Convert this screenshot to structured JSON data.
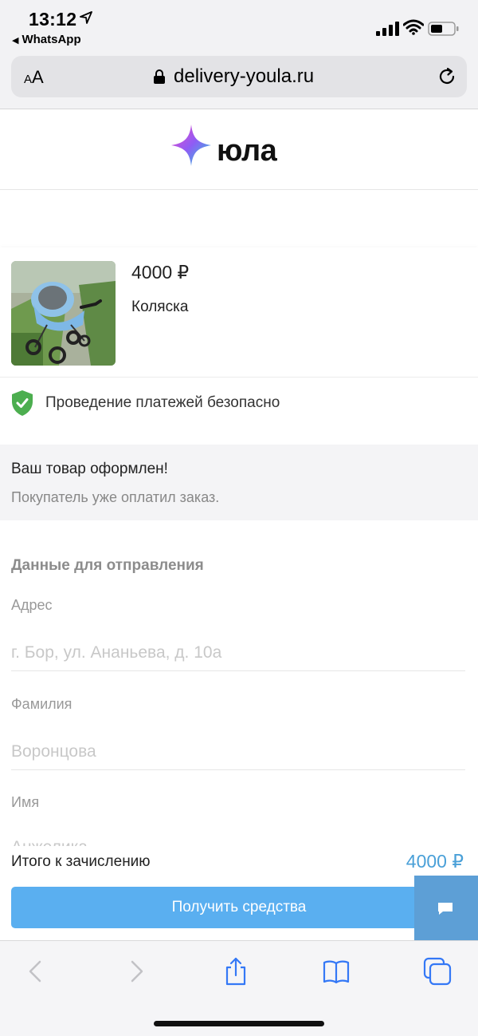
{
  "status_bar": {
    "time": "13:12",
    "back_app": "WhatsApp",
    "icons": [
      "location-arrow-icon",
      "signal-icon",
      "wifi-icon",
      "battery-icon"
    ]
  },
  "browser": {
    "text_size_label": "AA",
    "domain": "delivery-youla.ru",
    "icons": [
      "lock-icon",
      "reload-icon"
    ],
    "toolbar_icons": [
      "back-icon",
      "forward-icon",
      "share-icon",
      "bookmarks-icon",
      "tabs-icon"
    ]
  },
  "brand": {
    "name": "юла",
    "colors": {
      "star_from": "#f04cc6",
      "star_to": "#22d6d8"
    }
  },
  "product": {
    "price": "4000 ₽",
    "title": "Коляска"
  },
  "secure": {
    "text": "Проведение платежей безопасно",
    "color": "#4cae4f"
  },
  "notice": {
    "title": "Ваш товар оформлен!",
    "subtitle": "Покупатель уже оплатил заказ."
  },
  "form": {
    "section_title": "Данные для отправления",
    "fields": [
      {
        "label": "Адрес",
        "placeholder": "г. Бор, ул. Ананьева, д. 10а"
      },
      {
        "label": "Фамилия",
        "placeholder": "Воронцова"
      },
      {
        "label": "Имя",
        "placeholder": "Анжелика"
      }
    ]
  },
  "summary": {
    "total_label": "Итого к зачислению",
    "total_value": "4000 ₽",
    "accent": "#4aa0d8"
  },
  "actions": {
    "get_funds": "Получить средства",
    "button_color": "#5aaff0"
  }
}
